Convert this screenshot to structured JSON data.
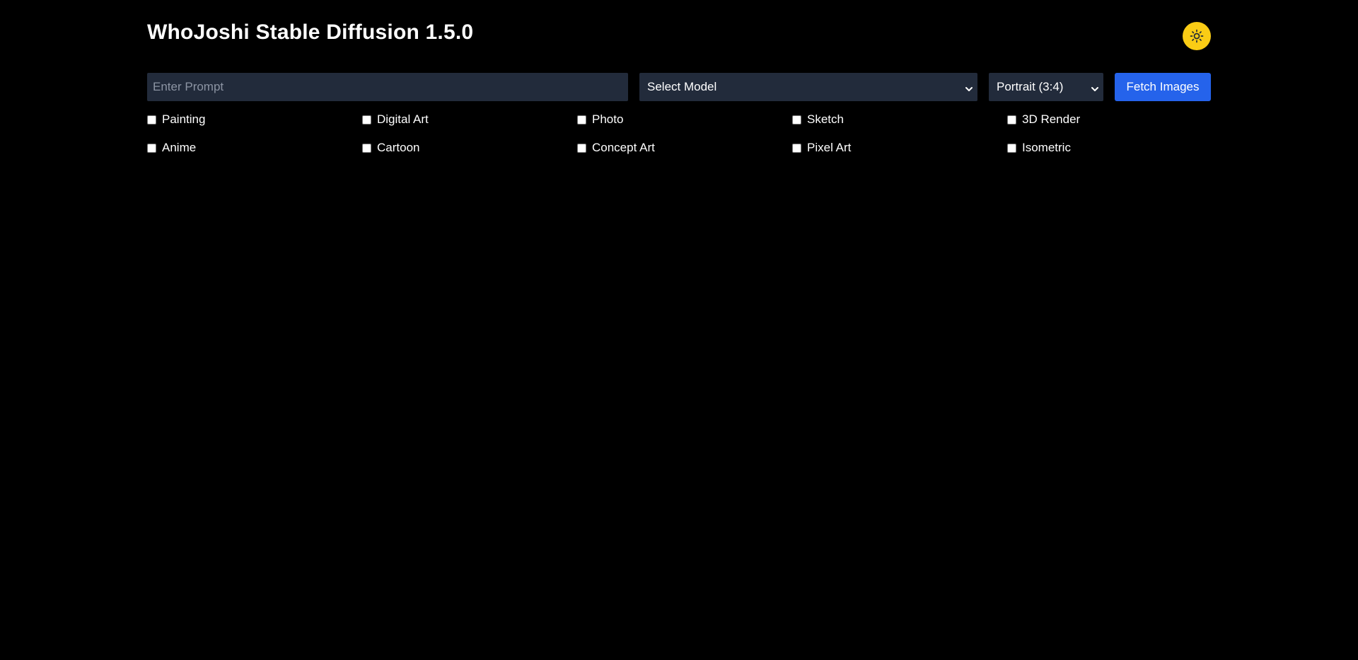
{
  "app": {
    "title": "WhoJoshi Stable Diffusion 1.5.0",
    "theme_icon": "sun-icon",
    "theme_toggle_color": "#facc15"
  },
  "controls": {
    "prompt_placeholder": "Enter Prompt",
    "prompt_value": "",
    "model_select": {
      "selected": "Select Model"
    },
    "aspect_select": {
      "selected": "Portrait (3:4)"
    },
    "fetch_label": "Fetch Images",
    "fetch_color": "#2563eb"
  },
  "styles": {
    "row1": [
      {
        "label": "Painting",
        "checked": false
      },
      {
        "label": "Digital Art",
        "checked": false
      },
      {
        "label": "Photo",
        "checked": false
      },
      {
        "label": "Sketch",
        "checked": false
      },
      {
        "label": "3D Render",
        "checked": false
      }
    ],
    "row2": [
      {
        "label": "Anime",
        "checked": false
      },
      {
        "label": "Cartoon",
        "checked": false
      },
      {
        "label": "Concept Art",
        "checked": false
      },
      {
        "label": "Pixel Art",
        "checked": false
      },
      {
        "label": "Isometric",
        "checked": false
      }
    ]
  },
  "colors": {
    "background": "#000000",
    "input_background": "#222b3b",
    "text": "#ffffff"
  }
}
